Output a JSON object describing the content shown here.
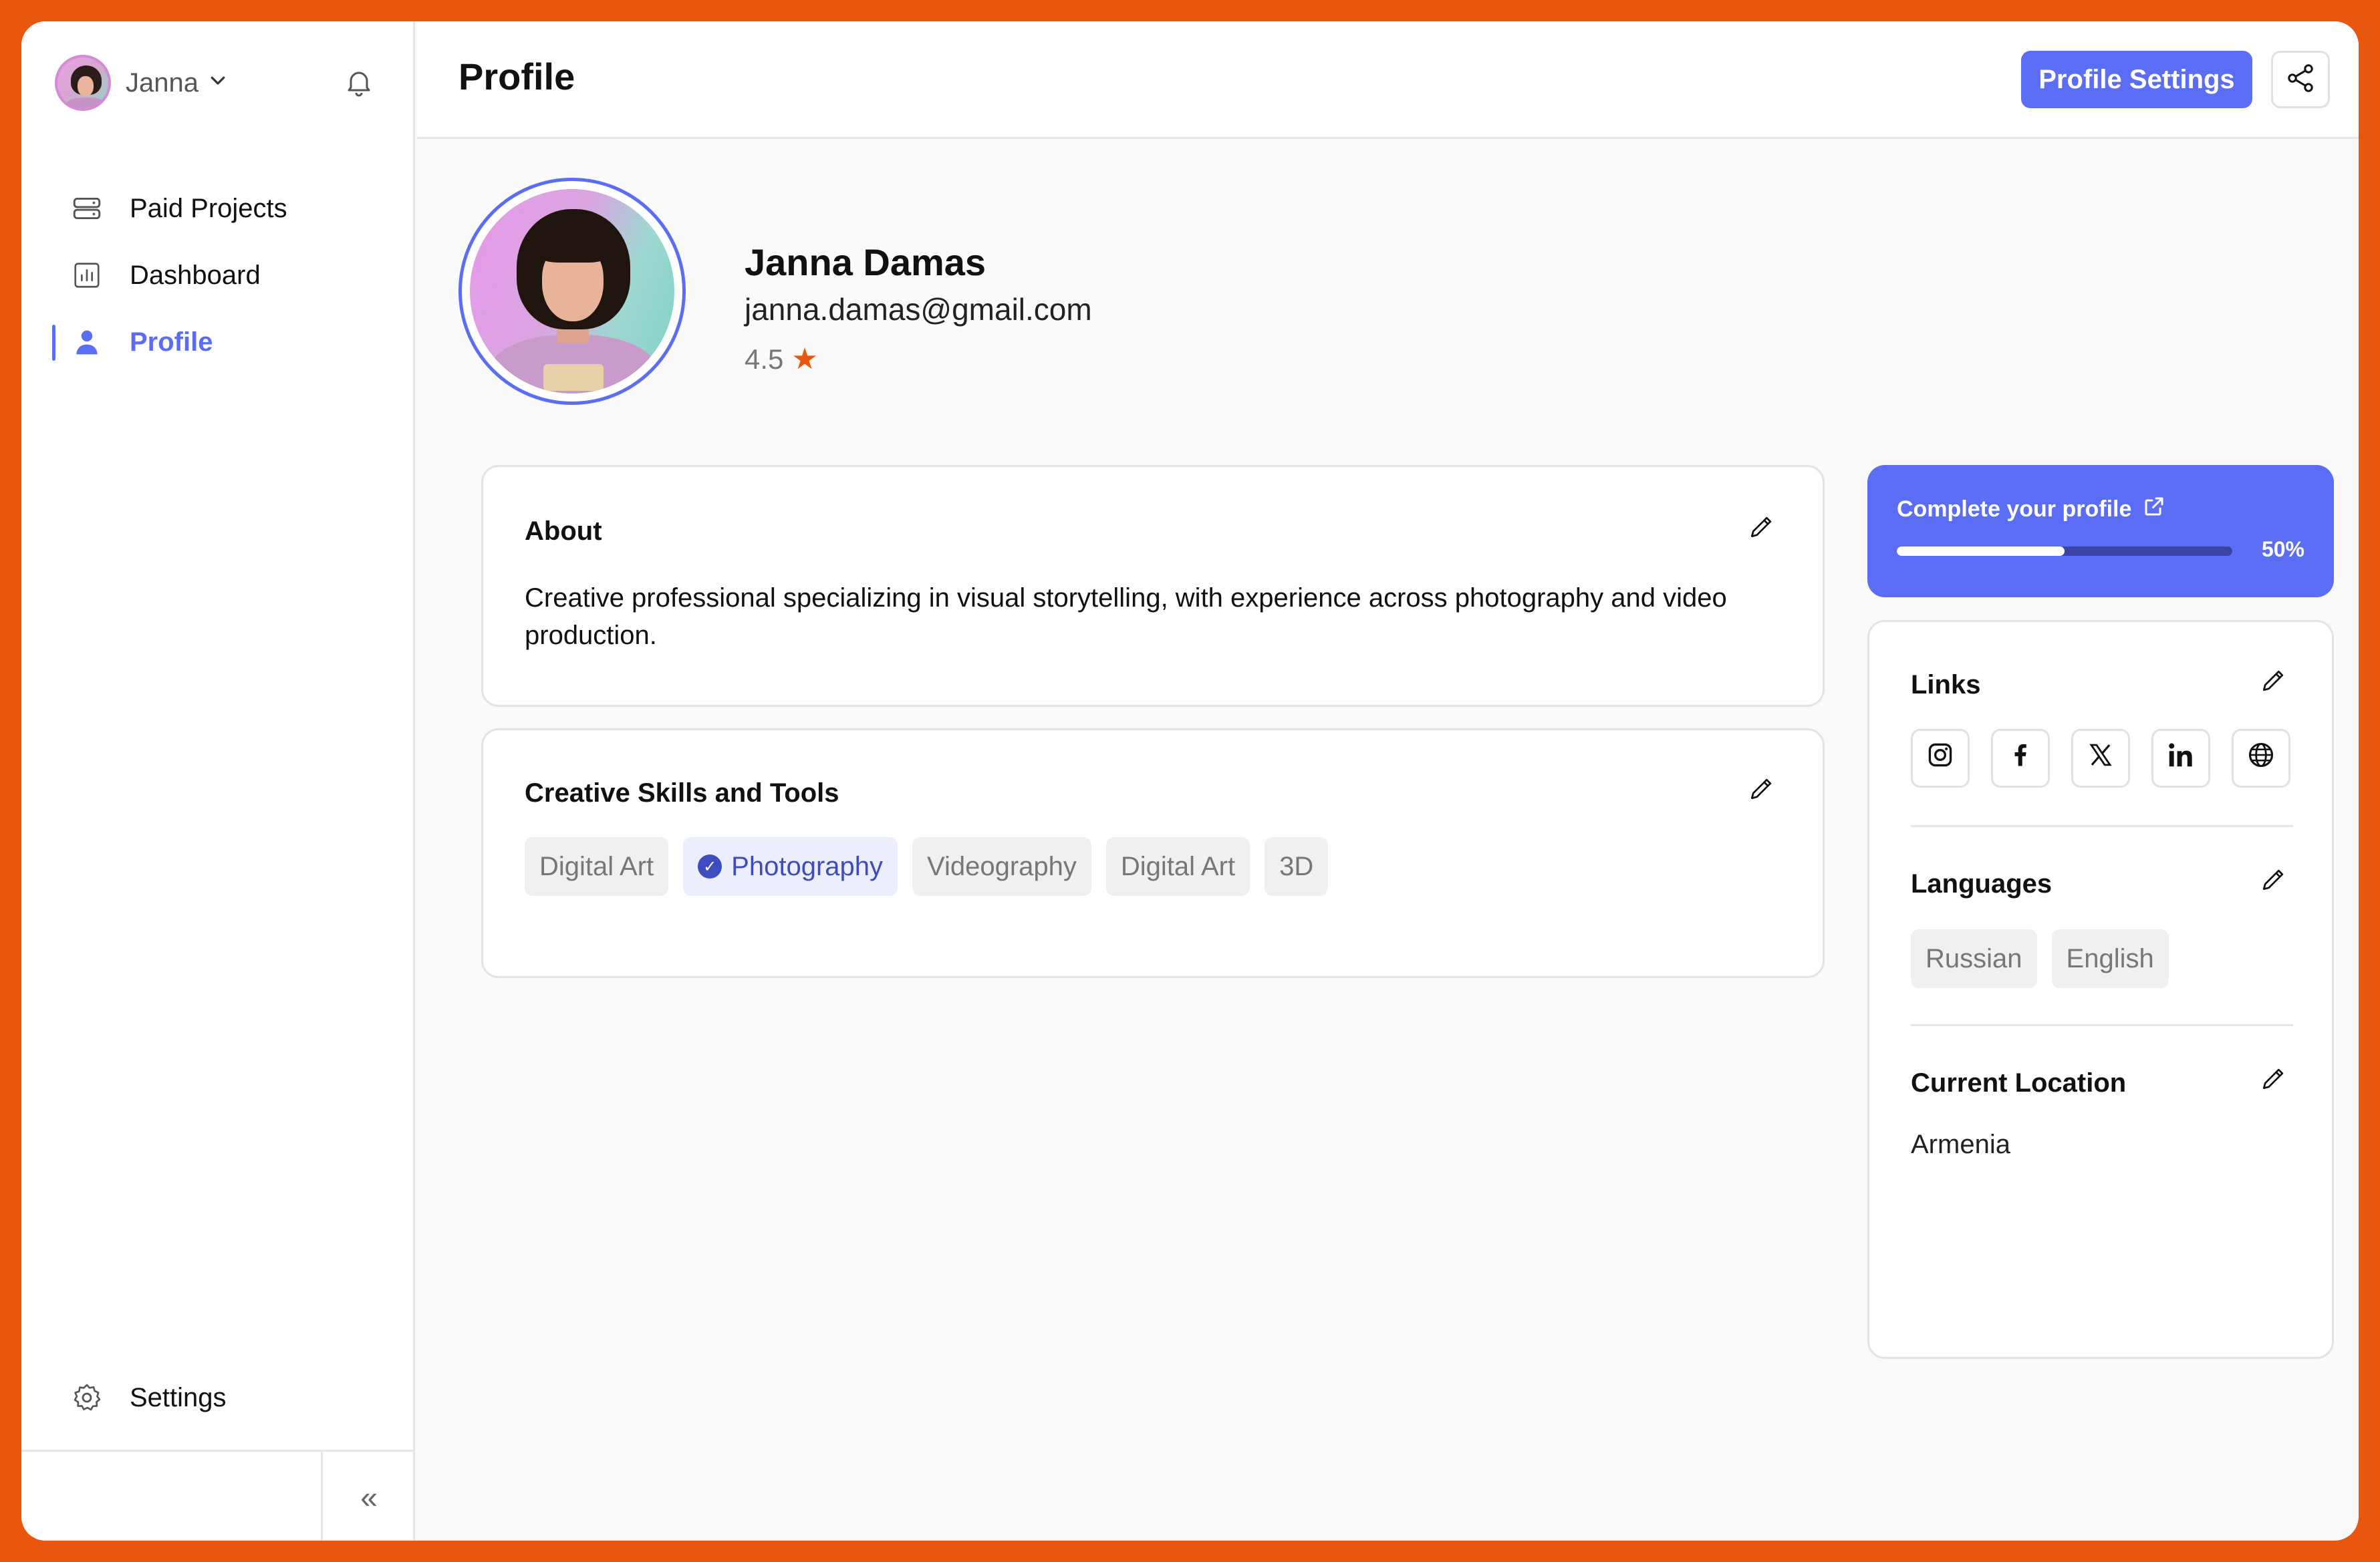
{
  "sidebar": {
    "user_name": "Janna",
    "items": [
      {
        "label": "Paid Projects",
        "icon": "server-icon"
      },
      {
        "label": "Dashboard",
        "icon": "bar-chart-icon"
      },
      {
        "label": "Profile",
        "icon": "user-icon",
        "active": true
      }
    ],
    "settings_label": "Settings",
    "collapse_glyph": "«"
  },
  "header": {
    "title": "Profile",
    "settings_button": "Profile Settings"
  },
  "profile": {
    "name": "Janna Damas",
    "email": "janna.damas@gmail.com",
    "rating": "4.5"
  },
  "about": {
    "title": "About",
    "text": "Creative professional specializing in visual storytelling, with experience across photography and video production."
  },
  "skills": {
    "title": "Creative Skills and Tools",
    "chips": [
      "Digital Art",
      "Photography",
      "Videography",
      "Digital Art",
      "3D"
    ],
    "selected_index": 1
  },
  "complete": {
    "title": "Complete your profile",
    "percent_label": "50%",
    "progress": 0.5
  },
  "links": {
    "title": "Links",
    "items": [
      "instagram-icon",
      "facebook-icon",
      "x-icon",
      "linkedin-icon",
      "globe-icon"
    ]
  },
  "languages": {
    "title": "Languages",
    "items": [
      "Russian",
      "English"
    ]
  },
  "location": {
    "title": "Current Location",
    "value": "Armenia"
  },
  "colors": {
    "accent": "#5B6CF5",
    "frame": "#E8560F",
    "star": "#E8560F"
  }
}
